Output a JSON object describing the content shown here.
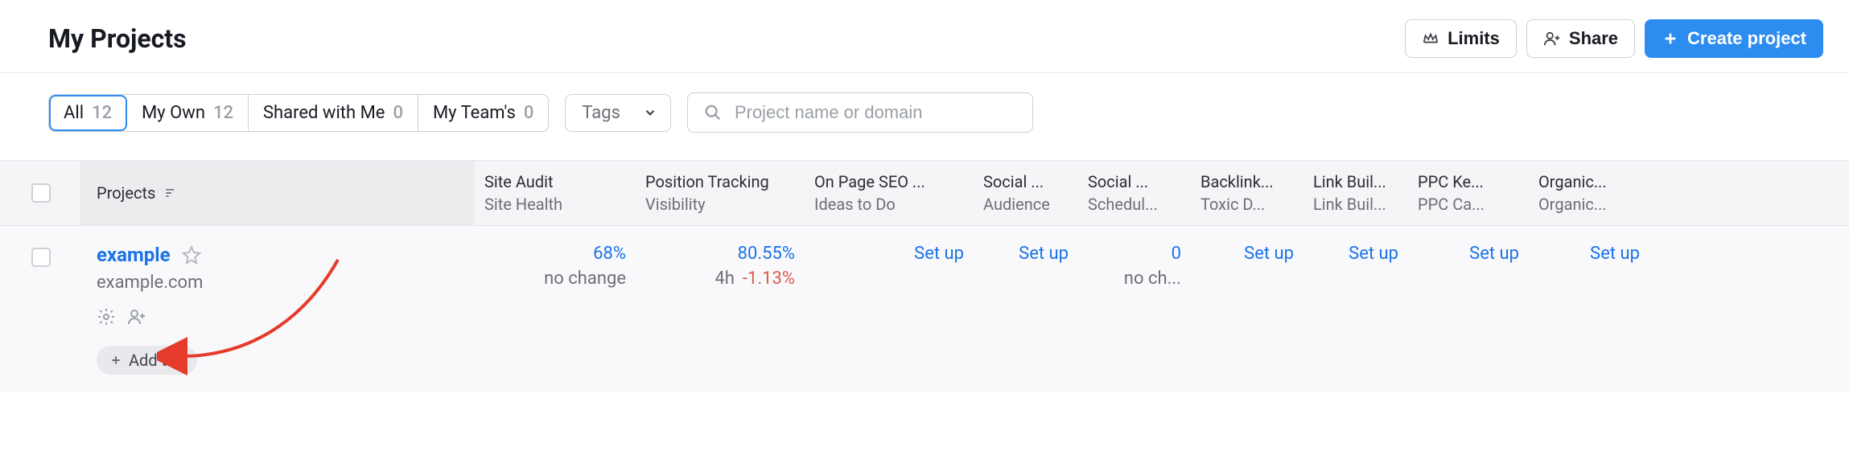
{
  "header": {
    "title": "My Projects",
    "limits_label": "Limits",
    "share_label": "Share",
    "create_label": "Create project"
  },
  "filters": {
    "all_label": "All",
    "all_count": "12",
    "own_label": "My Own",
    "own_count": "12",
    "shared_label": "Shared with Me",
    "shared_count": "0",
    "team_label": "My Team's",
    "team_count": "0",
    "tags_label": "Tags",
    "search_placeholder": "Project name or domain"
  },
  "columns": {
    "projects": "Projects",
    "audit_main": "Site Audit",
    "audit_sub": "Site Health",
    "pos_main": "Position Tracking",
    "pos_sub": "Visibility",
    "seo_main": "On Page SEO ...",
    "seo_sub": "Ideas to Do",
    "soc1_main": "Social ...",
    "soc1_sub": "Audience",
    "soc2_main": "Social ...",
    "soc2_sub": "Schedul...",
    "back_main": "Backlink...",
    "back_sub": "Toxic D...",
    "link_main": "Link Buil...",
    "link_sub": "Link Buil...",
    "ppc_main": "PPC Ke...",
    "ppc_sub": "PPC Ca...",
    "org_main": "Organic...",
    "org_sub": "Organic..."
  },
  "row": {
    "name": "example",
    "domain": "example.com",
    "add_tag_label": "Add tag",
    "audit_val": "68%",
    "audit_sub": "no change",
    "pos_val": "80.55%",
    "pos_time": "4h",
    "pos_delta": "-1.13%",
    "seo_setup": "Set up",
    "soc1_setup": "Set up",
    "soc2_val": "0",
    "soc2_sub": "no ch...",
    "back_setup": "Set up",
    "link_setup": "Set up",
    "ppc_setup": "Set up",
    "org_setup": "Set up"
  }
}
